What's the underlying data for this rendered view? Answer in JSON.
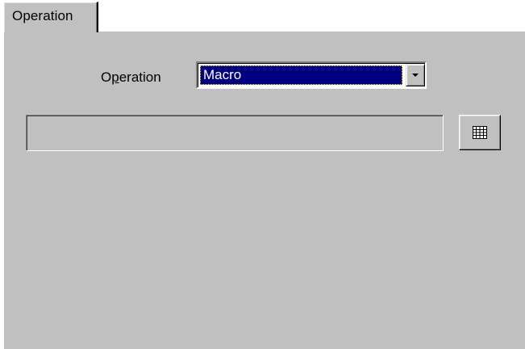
{
  "tab": {
    "label": "Operation"
  },
  "operation": {
    "label_prefix": "O",
    "label_mnemonic": "p",
    "label_suffix": "eration",
    "selected_value": "Macro"
  },
  "field": {
    "value": ""
  },
  "icons": {
    "dropdown": "chevron-down-icon",
    "grid": "grid-icon"
  },
  "colors": {
    "panel": "#c0c0c0",
    "selection": "#000080",
    "selection_text": "#ffffff"
  }
}
